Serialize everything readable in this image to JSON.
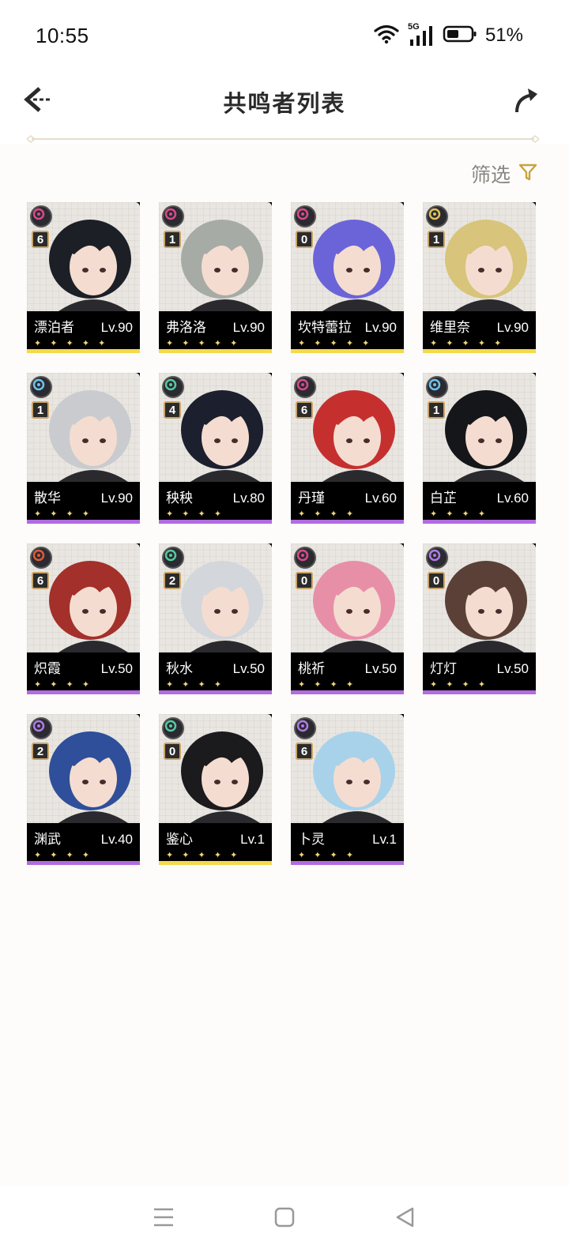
{
  "status_bar": {
    "time": "10:55",
    "network": "5G",
    "battery": "51%",
    "icons": [
      "wifi-icon",
      "signal-icon",
      "battery-icon"
    ]
  },
  "header": {
    "title": "共鸣者列表",
    "back_icon": "back-arrow-icon",
    "share_icon": "share-icon"
  },
  "filter": {
    "label": "筛选",
    "icon": "filter-icon"
  },
  "colors": {
    "five_star": "#f7d84a",
    "four_star": "#b26be0",
    "spectro": "#e0c15a",
    "fusion": "#e05a3a",
    "glacio": "#6ec2f0",
    "aero": "#55c9a0",
    "electro": "#b07be6",
    "havoc": "#d94a8a"
  },
  "characters": [
    {
      "name": "漂泊者",
      "level": "Lv.90",
      "constellation": "6",
      "stars": "✦ ✦ ✦ ✦ ✦",
      "rarity": 5,
      "element": "havoc",
      "hair": "#1d1f26"
    },
    {
      "name": "弗洛洛",
      "level": "Lv.90",
      "constellation": "1",
      "stars": "✦ ✦ ✦ ✦ ✦",
      "rarity": 5,
      "element": "havoc",
      "hair": "#a7aba6"
    },
    {
      "name": "坎特蕾拉",
      "level": "Lv.90",
      "constellation": "0",
      "stars": "✦ ✦ ✦ ✦ ✦",
      "rarity": 5,
      "element": "havoc",
      "hair": "#6b64d8"
    },
    {
      "name": "维里奈",
      "level": "Lv.90",
      "constellation": "1",
      "stars": "✦ ✦ ✦ ✦ ✦",
      "rarity": 5,
      "element": "spectro",
      "hair": "#d8c47a"
    },
    {
      "name": "散华",
      "level": "Lv.90",
      "constellation": "1",
      "stars": "✦ ✦ ✦ ✦",
      "rarity": 4,
      "element": "glacio",
      "hair": "#c9cbcf"
    },
    {
      "name": "秧秧",
      "level": "Lv.80",
      "constellation": "4",
      "stars": "✦ ✦ ✦ ✦",
      "rarity": 4,
      "element": "aero",
      "hair": "#1c1f2e"
    },
    {
      "name": "丹瑾",
      "level": "Lv.60",
      "constellation": "6",
      "stars": "✦ ✦ ✦ ✦",
      "rarity": 4,
      "element": "havoc",
      "hair": "#c5302f"
    },
    {
      "name": "白芷",
      "level": "Lv.60",
      "constellation": "1",
      "stars": "✦ ✦ ✦ ✦",
      "rarity": 4,
      "element": "glacio",
      "hair": "#15161a"
    },
    {
      "name": "炽霞",
      "level": "Lv.50",
      "constellation": "6",
      "stars": "✦ ✦ ✦ ✦",
      "rarity": 4,
      "element": "fusion",
      "hair": "#a3302a"
    },
    {
      "name": "秋水",
      "level": "Lv.50",
      "constellation": "2",
      "stars": "✦ ✦ ✦ ✦",
      "rarity": 4,
      "element": "aero",
      "hair": "#d3d6da"
    },
    {
      "name": "桃祈",
      "level": "Lv.50",
      "constellation": "0",
      "stars": "✦ ✦ ✦ ✦",
      "rarity": 4,
      "element": "havoc",
      "hair": "#e88fa8"
    },
    {
      "name": "灯灯",
      "level": "Lv.50",
      "constellation": "0",
      "stars": "✦ ✦ ✦ ✦",
      "rarity": 4,
      "element": "electro",
      "hair": "#5a4036"
    },
    {
      "name": "渊武",
      "level": "Lv.40",
      "constellation": "2",
      "stars": "✦ ✦ ✦ ✦",
      "rarity": 4,
      "element": "electro",
      "hair": "#2f4f9a"
    },
    {
      "name": "鉴心",
      "level": "Lv.1",
      "constellation": "0",
      "stars": "✦ ✦ ✦ ✦ ✦",
      "rarity": 5,
      "element": "aero",
      "hair": "#1b1b1e"
    },
    {
      "name": "卜灵",
      "level": "Lv.1",
      "constellation": "6",
      "stars": "✦ ✦ ✦ ✦",
      "rarity": 4,
      "element": "electro",
      "hair": "#a8d2ea"
    }
  ],
  "nav_bar": {
    "icons": [
      "menu-icon",
      "home-icon",
      "back-icon"
    ]
  }
}
